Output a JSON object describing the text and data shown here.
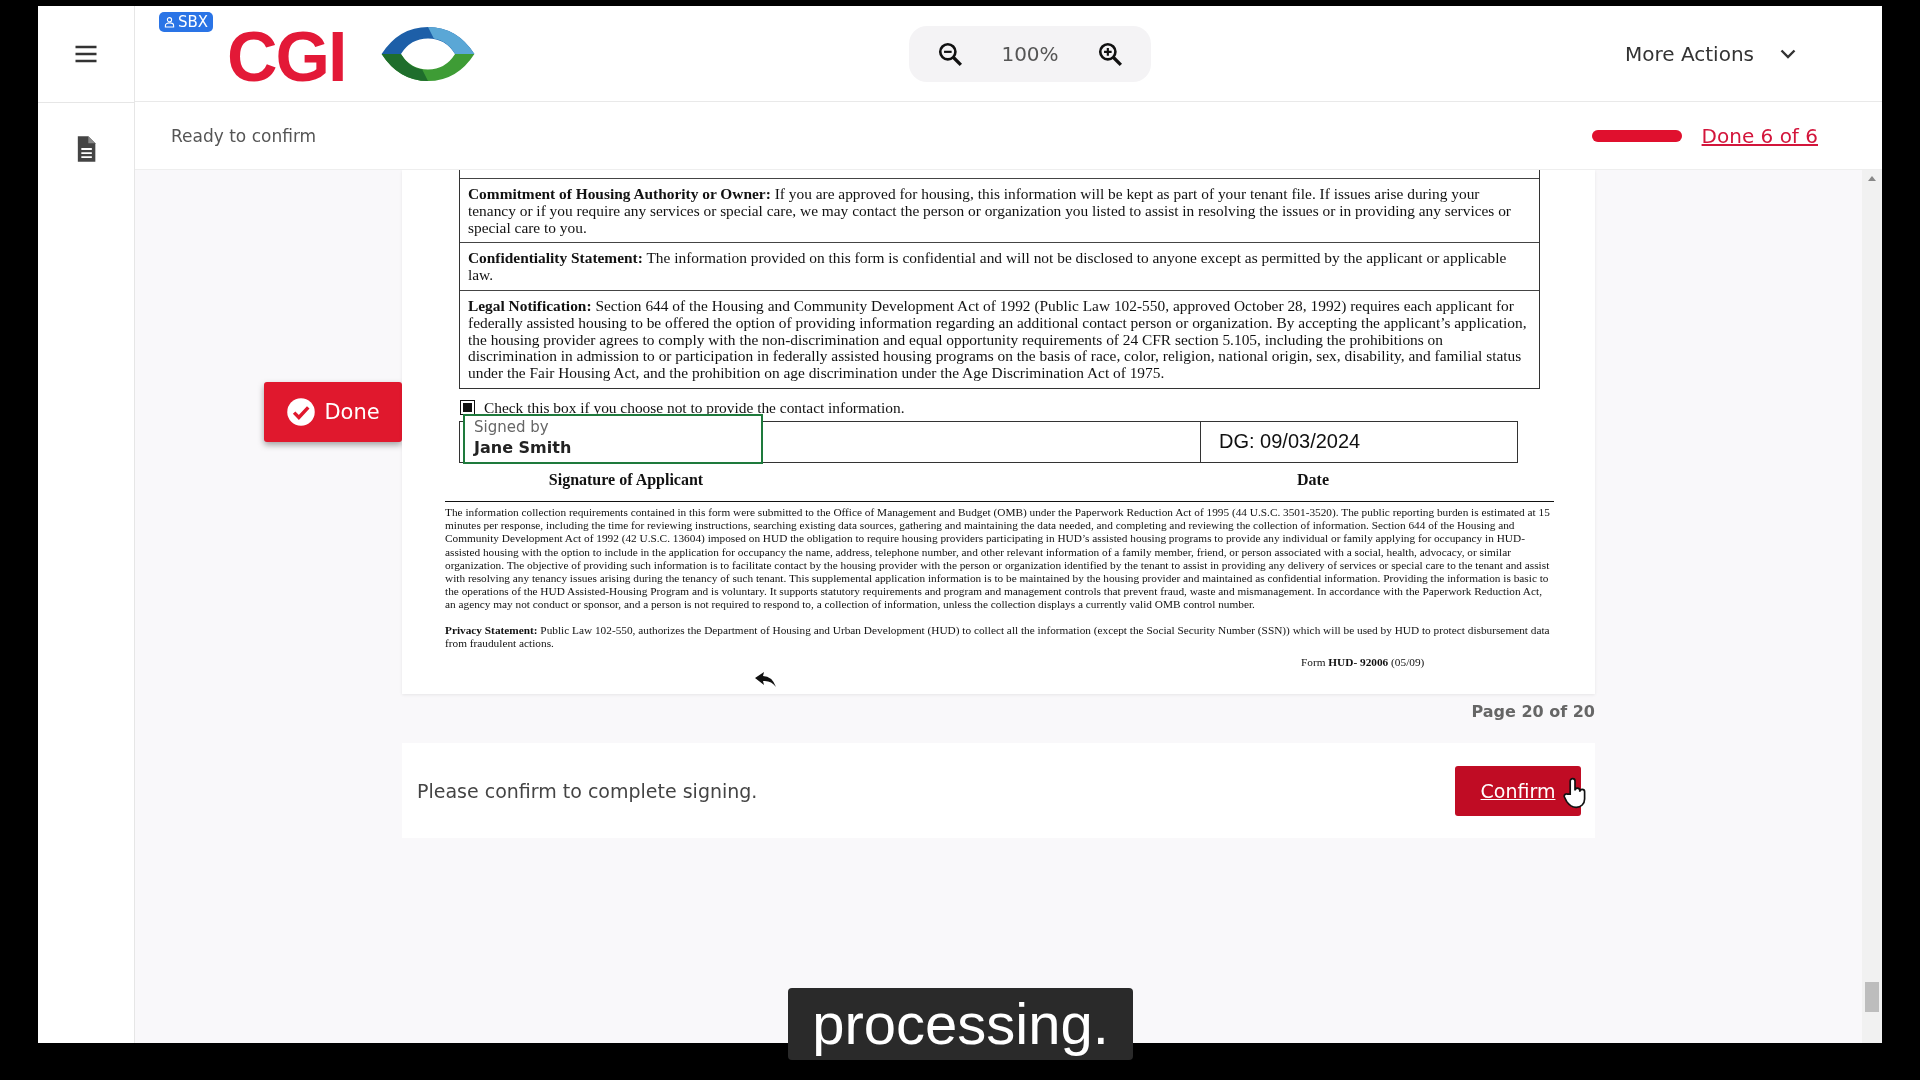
{
  "header": {
    "badge": "SBX",
    "logo_text": "CGI",
    "zoom": {
      "value": "100%"
    },
    "more_actions": "More Actions"
  },
  "status": {
    "text": "Ready to confirm",
    "progress": {
      "level": 1
    },
    "done_link": "Done 6 of 6"
  },
  "done_button": "Done",
  "document": {
    "sections": [
      {
        "text": "**Commitment of Housing Authority or Owner:**  If you are approved for housing, this information will be kept as part of your tenant file.  If issues arise during your tenancy or if you require any services or special care, we may contact the person or organization you listed to assist in resolving the issues or in providing any services or special care to you."
      },
      {
        "text": "**Confidentiality Statement:** The information provided on this form is confidential and will not be disclosed to anyone except as permitted by the applicant or applicable law."
      },
      {
        "text": "**Legal Notification:** Section 644 of the Housing and Community Development Act of 1992 (Public Law 102-550, approved October 28, 1992) requires each applicant for federally assisted housing to be offered the option of providing information regarding an additional contact person or organization. By accepting the applicant’s application, the housing provider agrees to comply with the non-discrimination and equal opportunity requirements of 24 CFR section 5.105, including the prohibitions on discrimination in admission to or participation in federally assisted housing programs on the basis of race, color, religion, national origin, sex, disability, and familial status under the Fair Housing Act, and the prohibition on age discrimination under the Age Discrimination Act of 1975."
      }
    ],
    "opt_out": {
      "label": "Check this box if you choose not to provide the contact information.",
      "checked": true
    },
    "signature": {
      "caption": "Signed by",
      "name": "Jane Smith",
      "date": "DG: 09/03/2024",
      "signature_label": "Signature of Applicant",
      "date_label": "Date"
    },
    "paperwork_notice": "The information collection requirements contained in this form were submitted to the Office of Management and Budget (OMB) under the Paperwork Reduction Act of 1995 (44 U.S.C. 3501-3520).  The public reporting burden is estimated at 15 minutes per response, including the time for reviewing instructions, searching existing data sources, gathering and maintaining the data needed, and completing and reviewing the collection of information.  Section 644 of the Housing and Community Development Act of 1992 (42 U.S.C. 13604) imposed on HUD the obligation to require housing providers participating in HUD’s assisted housing programs to provide any individual or family applying for occupancy in HUD-assisted housing with the option to include in the application for occupancy the name, address, telephone number, and other relevant information of a family member, friend, or person associated with a social, health, advocacy, or similar organization. The objective of providing such information is to facilitate contact by the housing provider with the person or organization identified by the tenant to assist in providing any delivery of services or special care to the tenant and assist with resolving any tenancy issues arising during the tenancy of such tenant.  This supplemental application information is to be maintained by the housing provider and maintained as confidential information.  Providing the information is basic to the operations of the HUD Assisted-Housing Program and is voluntary.  It supports statutory requirements and program and management controls that prevent fraud, waste and mismanagement.  In accordance with the Paperwork Reduction Act, an agency may not conduct or sponsor, and a person is not required to respond to, a collection of information, unless the collection displays a currently valid OMB control number.",
    "privacy": "**Privacy Statement:** Public Law 102-550, authorizes the Department of Housing and Urban Development (HUD) to collect all the information (except the Social Security Number (SSN)) which will be used by HUD to protect disbursement data from fraudulent actions.",
    "form_id": "Form **HUD- 92006** (05/09)"
  },
  "page_indicator": "Page 20 of 20",
  "confirm_bar": {
    "message": "Please confirm to complete signing.",
    "button": "Confirm"
  },
  "caption": "processing."
}
